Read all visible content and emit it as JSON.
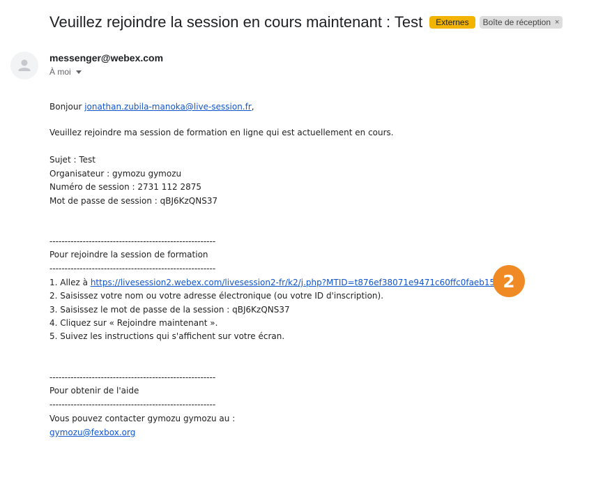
{
  "email": {
    "subject": "Veuillez rejoindre la session en cours maintenant : Test",
    "labels": {
      "externes": "Externes",
      "inbox": "Boîte de réception",
      "close": "×"
    },
    "sender": "messenger@webex.com",
    "recipient": "À moi"
  },
  "body": {
    "greeting_prefix": "Bonjour ",
    "greeting_email": "jonathan.zubila-manoka@live-session.fr",
    "greeting_suffix": ",",
    "intro": "Veuillez rejoindre ma session de formation en ligne qui est actuellement en cours.",
    "details": {
      "sujet": "Sujet : Test",
      "organisateur": "Organisateur : gymozu gymozu",
      "numero": "Numéro de session : 2731 112 2875",
      "mot_de_passe": "Mot de passe de session : qBJ6KzQNS37"
    },
    "separator": "-------------------------------------------------------",
    "join_heading": "Pour rejoindre la session de formation",
    "steps": {
      "step1_prefix": "1. Allez à ",
      "step1_link": "https://livesession2.webex.com/livesession2-fr/k2/j.php?MTID=t876ef38071e9471c60ffc0faeb155293",
      "step2": "2. Saisissez votre nom ou votre adresse électronique (ou votre ID d'inscription).",
      "step3": "3. Saisissez le mot de passe de la session : qBJ6KzQNS37",
      "step4": "4. Cliquez sur « Rejoindre maintenant ».",
      "step5": "5. Suivez les instructions qui s'affichent sur votre écran."
    },
    "help_heading": "Pour obtenir de l'aide",
    "contact_line": "Vous pouvez contacter gymozu gymozu au :",
    "contact_email": "gymozu@fexbox.org"
  },
  "callout_number": "2",
  "colors": {
    "link": "#1155cc",
    "label_externes": "#f3b400",
    "callout": "#f08a24"
  }
}
